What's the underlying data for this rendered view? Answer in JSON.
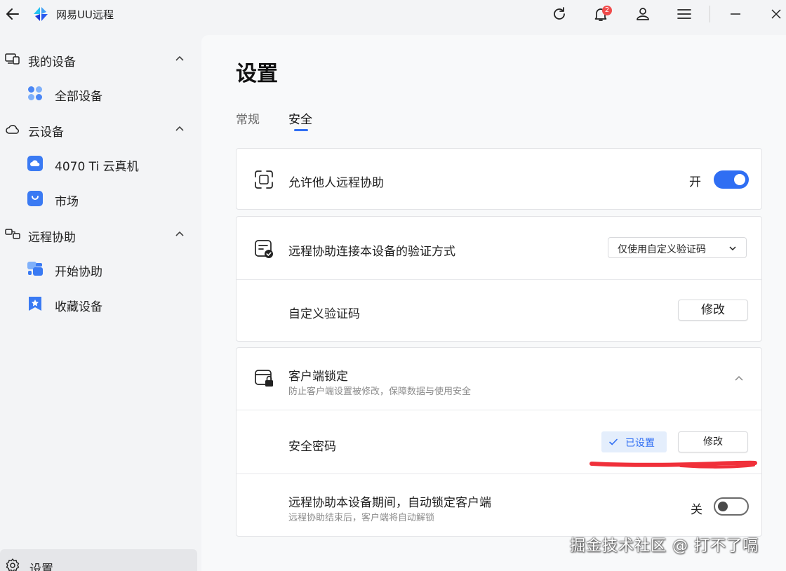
{
  "app": {
    "title": "网易UU远程"
  },
  "titlebar": {
    "notification_count": "2"
  },
  "sidebar": {
    "groups": [
      {
        "label": "我的设备",
        "items": [
          {
            "label": "全部设备"
          }
        ]
      },
      {
        "label": "云设备",
        "items": [
          {
            "label": "4070 Ti 云真机"
          },
          {
            "label": "市场"
          }
        ]
      },
      {
        "label": "远程协助",
        "items": [
          {
            "label": "开始协助"
          },
          {
            "label": "收藏设备"
          }
        ]
      }
    ],
    "settings_label": "设置"
  },
  "main": {
    "title": "设置",
    "tabs": [
      {
        "label": "常规",
        "active": false
      },
      {
        "label": "安全",
        "active": true
      }
    ],
    "allow_remote": {
      "label": "允许他人远程协助",
      "state_label": "开",
      "enabled": true
    },
    "verification": {
      "label": "远程协助连接本设备的验证方式",
      "selected_option": "仅使用自定义验证码",
      "custom_code_label": "自定义验证码",
      "modify_label": "修改"
    },
    "client_lock": {
      "title": "客户端锁定",
      "subtitle": "防止客户端设置被修改，保障数据与使用安全",
      "security_password_label": "安全密码",
      "status_label": "已设置",
      "modify_label": "修改",
      "auto_lock_title": "远程协助本设备期间，自动锁定客户端",
      "auto_lock_subtitle": "远程协助结束后，客户端将自动解锁",
      "auto_lock_state_label": "关",
      "auto_lock_enabled": false
    }
  },
  "watermark": "掘金技术社区 @ 打不了嗝",
  "colors": {
    "accent": "#2f6ef3",
    "annotation_red": "#f0303a",
    "badge_red": "#f04b4b"
  }
}
